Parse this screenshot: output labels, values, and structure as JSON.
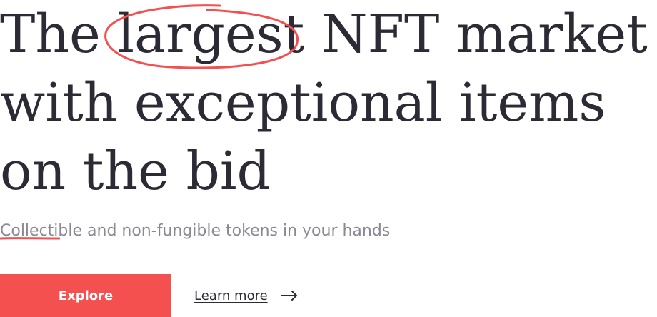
{
  "hero": {
    "headline": {
      "line1_before": "The ",
      "highlight": "largest",
      "line1_after": " NFT market",
      "line2": "with exceptional items",
      "line3": "on the bid"
    },
    "subtitle": "Collectible and non-fungible tokens in your hands",
    "primary_button": "Explore",
    "secondary_link": "Learn more",
    "icons": {
      "circle_mark": "hand-drawn-circle",
      "underline_mark": "hand-drawn-underline",
      "arrow": "arrow-right-icon"
    }
  },
  "colors": {
    "accent": "#f55050",
    "text": "#2b2a35",
    "muted": "#8a8893"
  }
}
